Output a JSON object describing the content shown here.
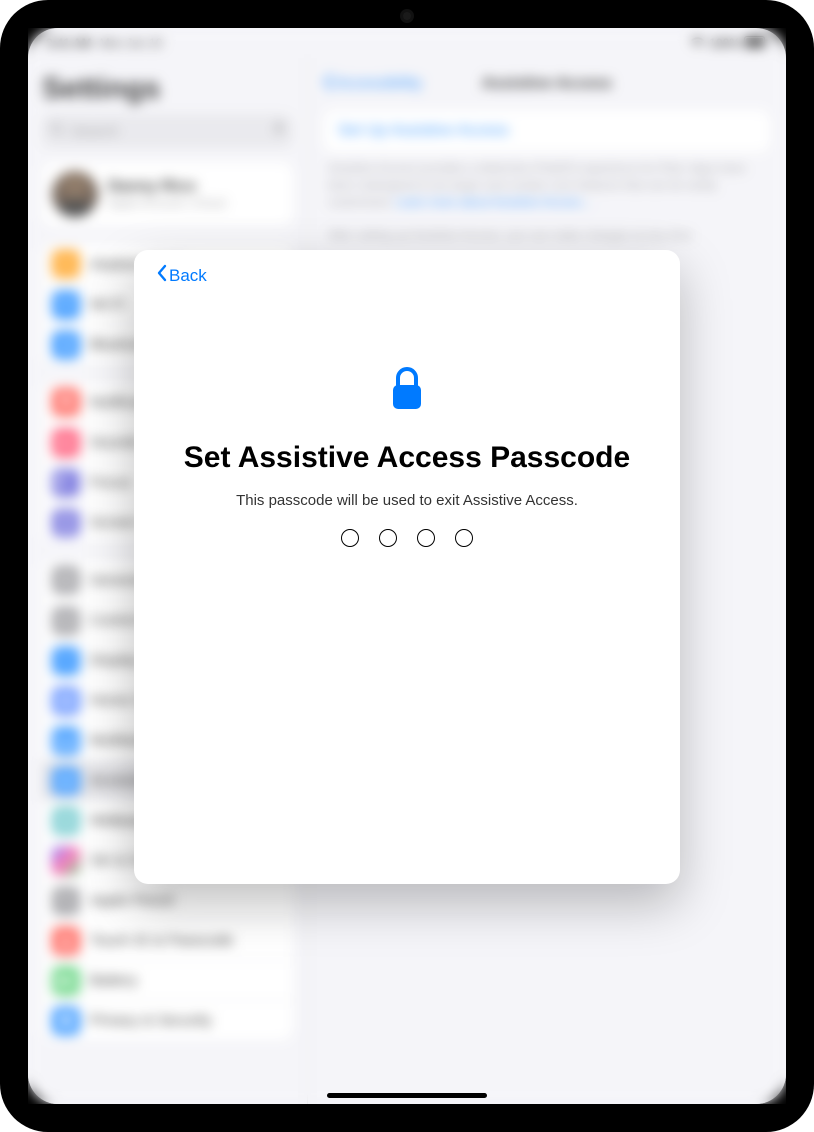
{
  "status": {
    "time": "9:41 AM",
    "date": "Mon Jun 10",
    "battery": "100%"
  },
  "sidebar": {
    "title": "Settings",
    "search_placeholder": "Search",
    "profile": {
      "name": "Danny Rico",
      "subtitle": "Apple Account, iCloud"
    },
    "group1": [
      {
        "icon": "airplane",
        "label": "Airplane Mode",
        "bg": "#ff9500"
      },
      {
        "icon": "wifi",
        "label": "Wi-Fi",
        "bg": "#007aff"
      },
      {
        "icon": "bluetooth",
        "label": "Bluetooth",
        "bg": "#007aff"
      }
    ],
    "group2": [
      {
        "icon": "bell",
        "label": "Notifications",
        "bg": "#ff3b30"
      },
      {
        "icon": "speaker",
        "label": "Sounds",
        "bg": "#ff2d55"
      },
      {
        "icon": "moon",
        "label": "Focus",
        "bg": "#5856d6"
      },
      {
        "icon": "hourglass",
        "label": "Screen Time",
        "bg": "#5856d6"
      }
    ],
    "group3": [
      {
        "icon": "gear",
        "label": "General",
        "bg": "#8e8e93"
      },
      {
        "icon": "switch",
        "label": "Control Center",
        "bg": "#8e8e93"
      },
      {
        "icon": "sun",
        "label": "Display & Brightness",
        "bg": "#007aff"
      },
      {
        "icon": "grid",
        "label": "Home Screen & App Library",
        "bg": "#3a75ff"
      },
      {
        "icon": "dock",
        "label": "Multitasking & Gestures",
        "bg": "#007aff"
      },
      {
        "icon": "access",
        "label": "Accessibility",
        "bg": "#007aff",
        "selected": true
      },
      {
        "icon": "flower",
        "label": "Wallpaper",
        "bg": "#55bfc4"
      },
      {
        "icon": "siri",
        "label": "Siri & Search",
        "bg": "#2b2b2d"
      },
      {
        "icon": "pencil",
        "label": "Apple Pencil",
        "bg": "#8e8e93"
      },
      {
        "icon": "touchid",
        "label": "Touch ID & Passcode",
        "bg": "#ff3b30"
      },
      {
        "icon": "battery",
        "label": "Battery",
        "bg": "#34c759"
      },
      {
        "icon": "hand",
        "label": "Privacy & Security",
        "bg": "#007aff"
      }
    ]
  },
  "main": {
    "back": "Accessibility",
    "title": "Assistive Access",
    "setup": "Set Up Assistive Access",
    "desc1": "Assistive Access provides a distinctive iPadOS experience for iPad. Apps have been redesigned to be larger and contain core features that can be easily customized. ",
    "learn": "Learn more about Assistive Access…",
    "desc2": "After setting up Assistive Access, you can make changes at any time"
  },
  "modal": {
    "back": "Back",
    "title": "Set Assistive Access Passcode",
    "subtitle": "This passcode will be used to exit Assistive Access.",
    "dots": 4
  }
}
